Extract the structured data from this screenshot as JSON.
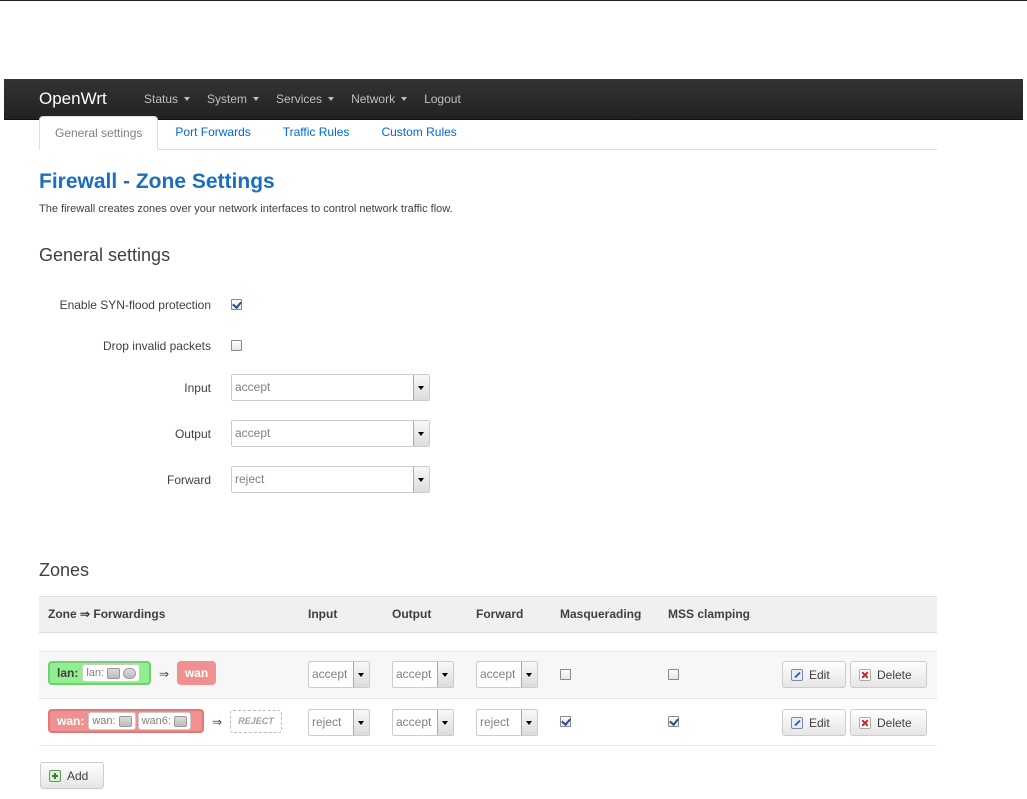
{
  "nav": {
    "brand": "OpenWrt",
    "items": [
      {
        "label": "Status",
        "dropdown": true
      },
      {
        "label": "System",
        "dropdown": true
      },
      {
        "label": "Services",
        "dropdown": true
      },
      {
        "label": "Network",
        "dropdown": true
      },
      {
        "label": "Logout",
        "dropdown": false
      }
    ]
  },
  "tabs": [
    {
      "label": "General settings",
      "active": true
    },
    {
      "label": "Port Forwards",
      "active": false
    },
    {
      "label": "Traffic Rules",
      "active": false
    },
    {
      "label": "Custom Rules",
      "active": false
    }
  ],
  "page": {
    "title": "Firewall - Zone Settings",
    "description": "The firewall creates zones over your network interfaces to control network traffic flow."
  },
  "general": {
    "heading": "General settings",
    "syn_flood_label": "Enable SYN-flood protection",
    "syn_flood_checked": true,
    "drop_invalid_label": "Drop invalid packets",
    "drop_invalid_checked": false,
    "input_label": "Input",
    "input_value": "accept",
    "output_label": "Output",
    "output_value": "accept",
    "forward_label": "Forward",
    "forward_value": "reject"
  },
  "zones": {
    "heading": "Zones",
    "columns": [
      "Zone ⇒ Forwardings",
      "Input",
      "Output",
      "Forward",
      "Masquerading",
      "MSS clamping"
    ],
    "rows": [
      {
        "zone": "lan:",
        "interfaces": [
          "lan:"
        ],
        "arrow": "⇒",
        "forward_to": "wan",
        "input": "accept",
        "output": "accept",
        "forward": "accept",
        "masq": false,
        "mss": false
      },
      {
        "zone": "wan:",
        "interfaces": [
          "wan:",
          "wan6:"
        ],
        "arrow": "⇒",
        "forward_to": "REJECT",
        "input": "reject",
        "output": "accept",
        "forward": "reject",
        "masq": true,
        "mss": true
      }
    ],
    "edit_label": "Edit",
    "delete_label": "Delete",
    "add_label": "Add"
  },
  "colors": {
    "navbar": "#222222",
    "title": "#1a6fc0",
    "link": "#0069d6",
    "zone_lan": "#90f090",
    "zone_wan": "#f09090"
  }
}
